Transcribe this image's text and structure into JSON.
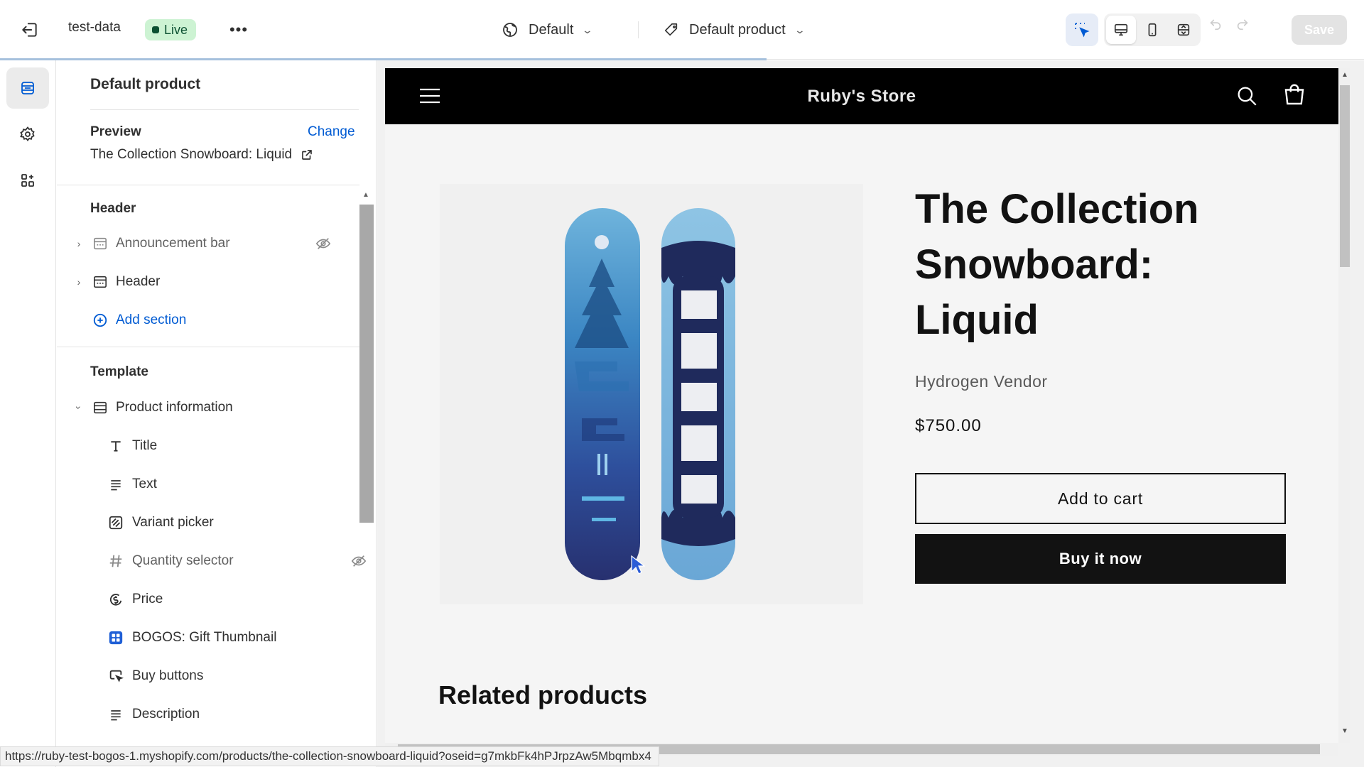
{
  "topbar": {
    "store_name": "test-data",
    "live_label": "Live",
    "more_label": "•••",
    "theme_label": "Default",
    "template_label": "Default product",
    "save_label": "Save"
  },
  "panel": {
    "title": "Default product",
    "preview_label": "Preview",
    "change_label": "Change",
    "preview_value": "The Collection Snowboard: Liquid",
    "header_section": "Header",
    "header_items": [
      {
        "label": "Announcement bar",
        "hidden": true
      },
      {
        "label": "Header",
        "hidden": false
      }
    ],
    "add_section_label": "Add section",
    "template_section": "Template",
    "product_info_label": "Product information",
    "blocks": [
      {
        "label": "Title",
        "icon": "title-icon"
      },
      {
        "label": "Text",
        "icon": "text-icon"
      },
      {
        "label": "Variant picker",
        "icon": "variant-icon"
      },
      {
        "label": "Quantity selector",
        "icon": "hash-icon",
        "hidden": true
      },
      {
        "label": "Price",
        "icon": "price-icon"
      },
      {
        "label": "BOGOS: Gift Thumbnail",
        "icon": "app-block-icon"
      },
      {
        "label": "Buy buttons",
        "icon": "cursor-click-icon"
      },
      {
        "label": "Description",
        "icon": "text-icon"
      }
    ]
  },
  "store": {
    "name": "Ruby's Store",
    "product_title": "The Collection Snowboard: Liquid",
    "vendor": "Hydrogen Vendor",
    "price": "$750.00",
    "add_to_cart": "Add to cart",
    "buy_now": "Buy it now",
    "related_heading": "Related products"
  },
  "status_url": "https://ruby-test-bogos-1.myshopify.com/products/the-collection-snowboard-liquid?oseid=g7mkbFk4hPJrpzAw5Mbqmbx4",
  "colors": {
    "accent_link": "#005bd3",
    "live_badge_bg": "#cdf3d3",
    "store_header_bg": "#000000"
  }
}
